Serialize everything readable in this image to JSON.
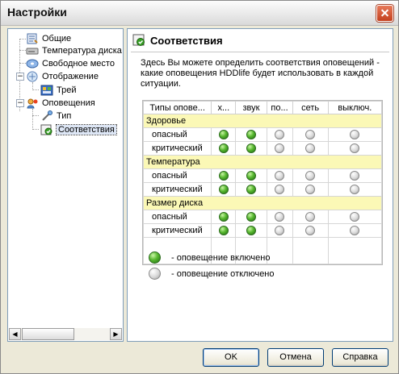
{
  "window": {
    "title": "Настройки"
  },
  "tree": {
    "items": [
      {
        "label": "Общие",
        "icon": "general-settings-icon"
      },
      {
        "label": "Температура диска",
        "icon": "hard-drive-icon"
      },
      {
        "label": "Свободное место",
        "icon": "disk-space-icon"
      },
      {
        "label": "Отображение",
        "icon": "display-icon",
        "expanded": true
      },
      {
        "label": "Трей",
        "icon": "tray-icon"
      },
      {
        "label": "Оповещения",
        "icon": "notifications-icon",
        "expanded": true
      },
      {
        "label": "Тип",
        "icon": "type-icon"
      },
      {
        "label": "Соответствия",
        "icon": "correspondence-icon",
        "selected": true
      }
    ]
  },
  "content": {
    "title": "Соответствия",
    "description": "Здесь Вы можете определить соответствия оповещений - какие оповещения HDDlife будет использовать в каждой ситуации.",
    "columns": [
      "Типы опове...",
      "х...",
      "звук",
      "по...",
      "сеть",
      "выключ."
    ],
    "groups": [
      {
        "label": "Здоровье",
        "rows": [
          {
            "label": "опасный",
            "states": [
              "on",
              "on",
              "off",
              "off",
              "off"
            ]
          },
          {
            "label": "критический",
            "states": [
              "on",
              "on",
              "off",
              "off",
              "off"
            ]
          }
        ]
      },
      {
        "label": "Температура",
        "rows": [
          {
            "label": "опасный",
            "states": [
              "on",
              "on",
              "off",
              "off",
              "off"
            ]
          },
          {
            "label": "критический",
            "states": [
              "on",
              "on",
              "off",
              "off",
              "off"
            ]
          }
        ]
      },
      {
        "label": "Размер диска",
        "rows": [
          {
            "label": "опасный",
            "states": [
              "on",
              "on",
              "off",
              "off",
              "off"
            ]
          },
          {
            "label": "критический",
            "states": [
              "on",
              "on",
              "off",
              "off",
              "off"
            ]
          }
        ]
      }
    ],
    "legend": {
      "on": "- оповещение включено",
      "off": "- оповещение отключено"
    }
  },
  "buttons": {
    "ok": "OK",
    "cancel": "Отмена",
    "help": "Справка"
  },
  "colors": {
    "group_row": "#fbf8b6",
    "led_on": "#58b830",
    "led_off": "#d9d9d9",
    "selection": "#dde6f5"
  }
}
